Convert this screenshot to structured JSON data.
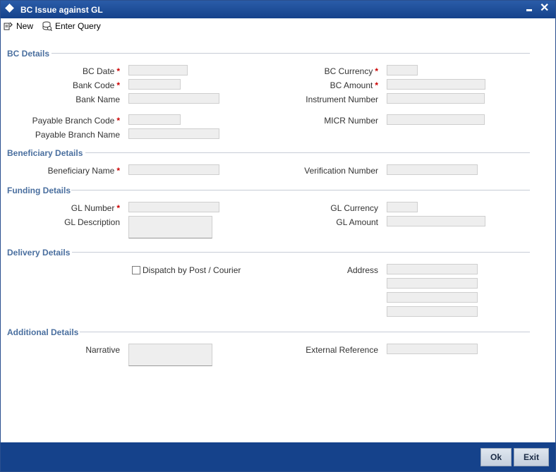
{
  "window": {
    "title": "BC Issue against GL"
  },
  "toolbar": {
    "new_label": "New",
    "enter_query_label": "Enter Query"
  },
  "sections": {
    "bc_details": "BC Details",
    "beneficiary_details": "Beneficiary Details",
    "funding_details": "Funding Details",
    "delivery_details": "Delivery Details",
    "additional_details": "Additional Details"
  },
  "labels": {
    "bc_date": "BC Date",
    "bank_code": "Bank Code",
    "bank_name": "Bank Name",
    "payable_branch_code": "Payable Branch Code",
    "payable_branch_name": "Payable Branch Name",
    "bc_currency": "BC Currency",
    "bc_amount": "BC Amount",
    "instrument_number": "Instrument Number",
    "micr_number": "MICR Number",
    "beneficiary_name": "Beneficiary Name",
    "verification_number": "Verification Number",
    "gl_number": "GL Number",
    "gl_description": "GL Description",
    "gl_currency": "GL Currency",
    "gl_amount": "GL Amount",
    "dispatch": "Dispatch by Post / Courier",
    "address": "Address",
    "narrative": "Narrative",
    "external_reference": "External Reference"
  },
  "required_marker": "*",
  "buttons": {
    "ok": "Ok",
    "exit": "Exit"
  }
}
